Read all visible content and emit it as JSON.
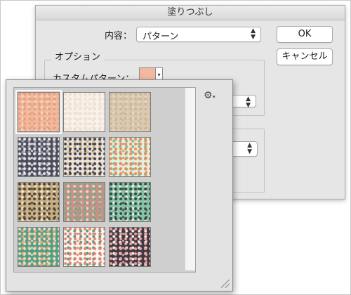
{
  "dialog": {
    "title": "塗りつぶし",
    "content_label": "内容：",
    "content_value": "パターン",
    "ok_label": "OK",
    "cancel_label": "キャンセル",
    "options_legend": "オプション",
    "custom_pattern_label": "カスタムパターン："
  },
  "picker": {
    "gear_icon": "⚙",
    "dropdown_icon": "▾",
    "tiles": [
      {
        "name": "peach-floral",
        "bg": "#f0b99c",
        "dots": [
          "#e89e7f",
          "#f7d2bf"
        ]
      },
      {
        "name": "cream-floral",
        "bg": "#f8f2ea",
        "dots": [
          "#ece0d0",
          "#f3e7da"
        ]
      },
      {
        "name": "beige-floral",
        "bg": "#dac8b0",
        "dots": [
          "#ccb79a",
          "#e6d6c2"
        ]
      },
      {
        "name": "navy-floral",
        "bg": "#4a4d5a",
        "dots": [
          "#e8e6ea",
          "#9c9aa8"
        ]
      },
      {
        "name": "white-dark-floral",
        "bg": "#eae4da",
        "dots": [
          "#3f3f4b",
          "#d9b583"
        ]
      },
      {
        "name": "white-orange-floral",
        "bg": "#e4eee0",
        "dots": [
          "#e88a55",
          "#89b594"
        ]
      },
      {
        "name": "brown-floral",
        "bg": "#c8ad83",
        "dots": [
          "#4c4333",
          "#efe4cf"
        ]
      },
      {
        "name": "rose-green-floral",
        "bg": "#c9908a",
        "dots": [
          "#7ea882",
          "#f2d3c6"
        ]
      },
      {
        "name": "mint-floral",
        "bg": "#86c2a6",
        "dots": [
          "#2f4945",
          "#f1e8d8"
        ]
      },
      {
        "name": "teal-floral",
        "bg": "#4da086",
        "dots": [
          "#f3d8bd",
          "#f2a173"
        ]
      },
      {
        "name": "white-red-floral",
        "bg": "#faf7f3",
        "dots": [
          "#e5826c",
          "#4d9b84"
        ]
      },
      {
        "name": "charcoal-floral",
        "bg": "#3c3a44",
        "dots": [
          "#f0a6a0",
          "#f5f1ed"
        ]
      }
    ]
  },
  "colors": {
    "dialog_bg": "#e6e6e6",
    "picker_bg": "#e3e3e3",
    "selected_swatch": "#f0b9a0"
  }
}
